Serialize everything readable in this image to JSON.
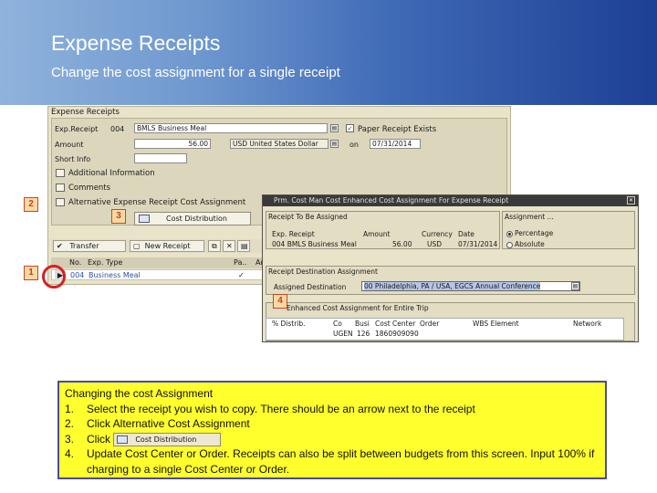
{
  "header": {
    "title": "Expense Receipts",
    "subtitle": "Change the cost assignment for a single receipt"
  },
  "colors": {
    "banner_start": "#8fb3dc",
    "banner_end": "#1d3f95",
    "note_bg": "#ffff2e",
    "marker_border": "#c14a2a"
  },
  "sap_main": {
    "window_title": "Expense Receipts",
    "exp_receipt_label": "Exp.Receipt",
    "exp_receipt_no": "004",
    "exp_receipt_value": "BMLS Business Meal",
    "paper_receipt_label": "Paper Receipt Exists",
    "paper_receipt_checked": "✓",
    "amount_label": "Amount",
    "amount_value": "56.00",
    "currency_value": "USD United States Dollar",
    "on_label": "on",
    "date_value": "07/31/2014",
    "short_info_label": "Short Info",
    "links": [
      "Additional Information",
      "Comments",
      "Alternative Expense Receipt Cost Assignment"
    ],
    "cost_distribution_button": "Cost Distribution",
    "toolbar": {
      "transfer": "Transfer",
      "new_receipt": "New Receipt"
    },
    "grid": {
      "headers": [
        "No.",
        "Exp. Type",
        "Pa..",
        "An"
      ],
      "row": {
        "no": "004",
        "exp_type": "Business Meal",
        "checked": "✓"
      }
    }
  },
  "sap_popup": {
    "title": "Prm. Cost Man Cost Enhanced Cost Assignment For Expense Receipt",
    "receipt_group_title": "Receipt To Be Assigned",
    "receipt_cols": [
      "Exp. Receipt",
      "Amount",
      "Currency",
      "Date"
    ],
    "receipt_row": {
      "receipt": "004 BMLS  Business Meal",
      "amount": "56.00",
      "currency": "USD",
      "date": "07/31/2014"
    },
    "assignment_group_title": "Assignment ...",
    "radio_percentage": "Percentage",
    "radio_absolute": "Absolute",
    "destination_group_title": "Receipt Destination Assignment",
    "assigned_destination_label": "Assigned Destination",
    "destination_value": "00 Philadelphia, PA / USA,  EGCS Annual Conference",
    "cost_group_title": "Enhanced Cost Assignment for Entire Trip",
    "cost_cols": [
      "% Distrib.",
      "Co",
      "Busi",
      "Cost Center",
      "Order",
      "WBS Element",
      "Network"
    ],
    "cost_row": {
      "co": "UGEN",
      "busi": "126",
      "cost_center": "1860909090"
    }
  },
  "markers": {
    "m1": "1",
    "m2": "2",
    "m3": "3",
    "m4": "4"
  },
  "instructions": {
    "heading": "Changing the cost Assignment",
    "steps": [
      {
        "num": "1.",
        "text": "Select the receipt you wish to copy. There should be an arrow next to the receipt"
      },
      {
        "num": "2.",
        "text": "Click Alternative Cost Assignment"
      },
      {
        "num": "3.",
        "text": "Click"
      },
      {
        "num": "4.",
        "text": "Update Cost Center or Order. Receipts can also be split between budgets from this screen. Input 100% if charging to a single Cost Center or Order."
      }
    ],
    "inline_button_label": "Cost Distribution"
  }
}
